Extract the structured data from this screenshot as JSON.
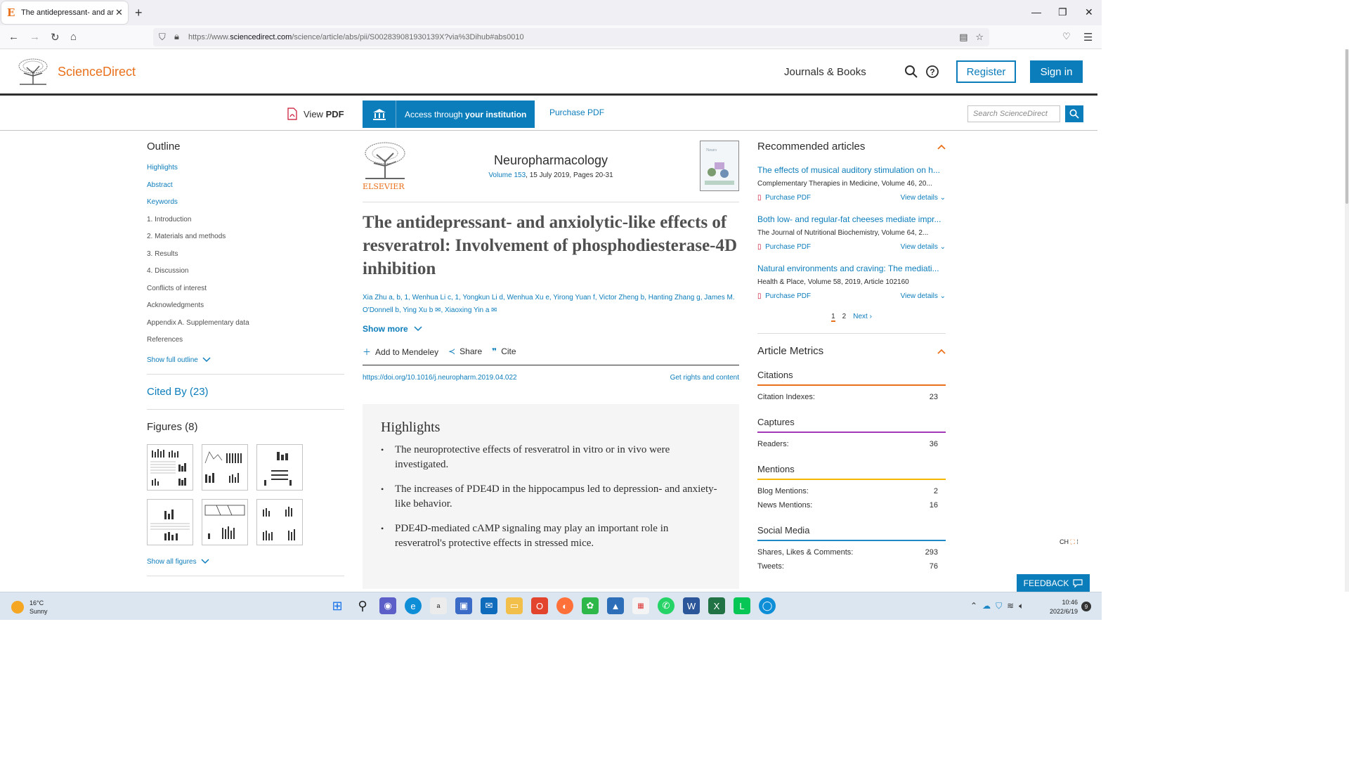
{
  "browser": {
    "tab_title": "The antidepressant- and anxiolyt",
    "url_prefix": "https://www.",
    "url_domain": "sciencedirect.com",
    "url_path": "/science/article/abs/pii/S002839081930139X?via%3Dihub#abs0010"
  },
  "header": {
    "brand": "ScienceDirect",
    "journals_books": "Journals & Books",
    "register": "Register",
    "sign_in": "Sign in"
  },
  "toolbar": {
    "view_pdf": "View ",
    "view_pdf_bold": "PDF",
    "access_text": "Access through ",
    "access_bold": "your institution",
    "purchase_pdf": "Purchase PDF",
    "search_placeholder": "Search ScienceDirect"
  },
  "outline": {
    "heading": "Outline",
    "items": [
      {
        "label": "Highlights",
        "link": true
      },
      {
        "label": "Abstract",
        "link": true
      },
      {
        "label": "Keywords",
        "link": true
      },
      {
        "label": "1. Introduction",
        "link": false
      },
      {
        "label": "2. Materials and methods",
        "link": false
      },
      {
        "label": "3. Results",
        "link": false
      },
      {
        "label": "4. Discussion",
        "link": false
      },
      {
        "label": "Conflicts of interest",
        "link": false
      },
      {
        "label": "Acknowledgments",
        "link": false
      },
      {
        "label": "Appendix A. Supplementary data",
        "link": false
      },
      {
        "label": "References",
        "link": false
      }
    ],
    "show_full": "Show full outline",
    "cited_by": "Cited By (23)",
    "figures": "Figures (8)",
    "show_all_figures": "Show all figures"
  },
  "article": {
    "publisher": "ELSEVIER",
    "journal": "Neuropharmacology",
    "volume_link": "Volume 153",
    "volume_rest": ", 15 July 2019, Pages 20-31",
    "title": "The antidepressant- and anxiolytic-like effects of resveratrol: Involvement of phosphodiesterase-4D inhibition",
    "authors_line1": "Xia Zhu a, b, 1, Wenhua Li c, 1, Yongkun Li d, Wenhua Xu e, Yirong Yuan f, Victor Zheng b, Hanting Zhang g, James M.",
    "authors_line2": "O'Donnell b, Ying Xu b ✉, Xiaoxing Yin a ✉",
    "show_more": "Show more",
    "add_mendeley": "Add to Mendeley",
    "share": "Share",
    "cite": "Cite",
    "doi": "https://doi.org/10.1016/j.neuropharm.2019.04.022",
    "rights": "Get rights and content",
    "highlights_heading": "Highlights",
    "highlights": [
      "The neuroprotective effects of resveratrol in vitro or in vivo were investigated.",
      "The increases of PDE4D in the hippocampus led to depression- and anxiety-like behavior.",
      "PDE4D-mediated cAMP signaling may play an important role in resveratrol's protective effects in stressed mice."
    ]
  },
  "recommended": {
    "heading": "Recommended articles",
    "items": [
      {
        "title": "The effects of musical auditory stimulation on h...",
        "source": "Complementary Therapies in Medicine, Volume 46, 20...",
        "purchase": "Purchase PDF",
        "details": "View details"
      },
      {
        "title": "Both low- and regular-fat cheeses mediate impr...",
        "source": "The Journal of Nutritional Biochemistry, Volume 64, 2...",
        "purchase": "Purchase PDF",
        "details": "View details"
      },
      {
        "title": "Natural environments and craving: The mediati...",
        "source": "Health & Place, Volume 58, 2019, Article 102160",
        "purchase": "Purchase PDF",
        "details": "View details"
      }
    ],
    "page1": "1",
    "page2": "2",
    "next": "Next"
  },
  "metrics": {
    "heading": "Article Metrics",
    "citations": {
      "label": "Citations",
      "color": "#e9711c",
      "rows": [
        {
          "k": "Citation Indexes:",
          "v": "23"
        }
      ]
    },
    "captures": {
      "label": "Captures",
      "color": "#a538b8",
      "rows": [
        {
          "k": "Readers:",
          "v": "36"
        }
      ]
    },
    "mentions": {
      "label": "Mentions",
      "color": "#f5b800",
      "rows": [
        {
          "k": "Blog Mentions:",
          "v": "2"
        },
        {
          "k": "News Mentions:",
          "v": "16"
        }
      ]
    },
    "social": {
      "label": "Social Media",
      "color": "#1e88c7",
      "rows": [
        {
          "k": "Shares, Likes & Comments:",
          "v": "293"
        },
        {
          "k": "Tweets:",
          "v": "76"
        }
      ]
    }
  },
  "feedback": "FEEDBACK",
  "ime": "CH",
  "taskbar": {
    "temp": "16°C",
    "weather": "Sunny",
    "time": "10:46",
    "date": "2022/6/19",
    "notifications": "9"
  },
  "colors": {
    "accent": "#0c7dbb",
    "brand": "#e9711c"
  }
}
